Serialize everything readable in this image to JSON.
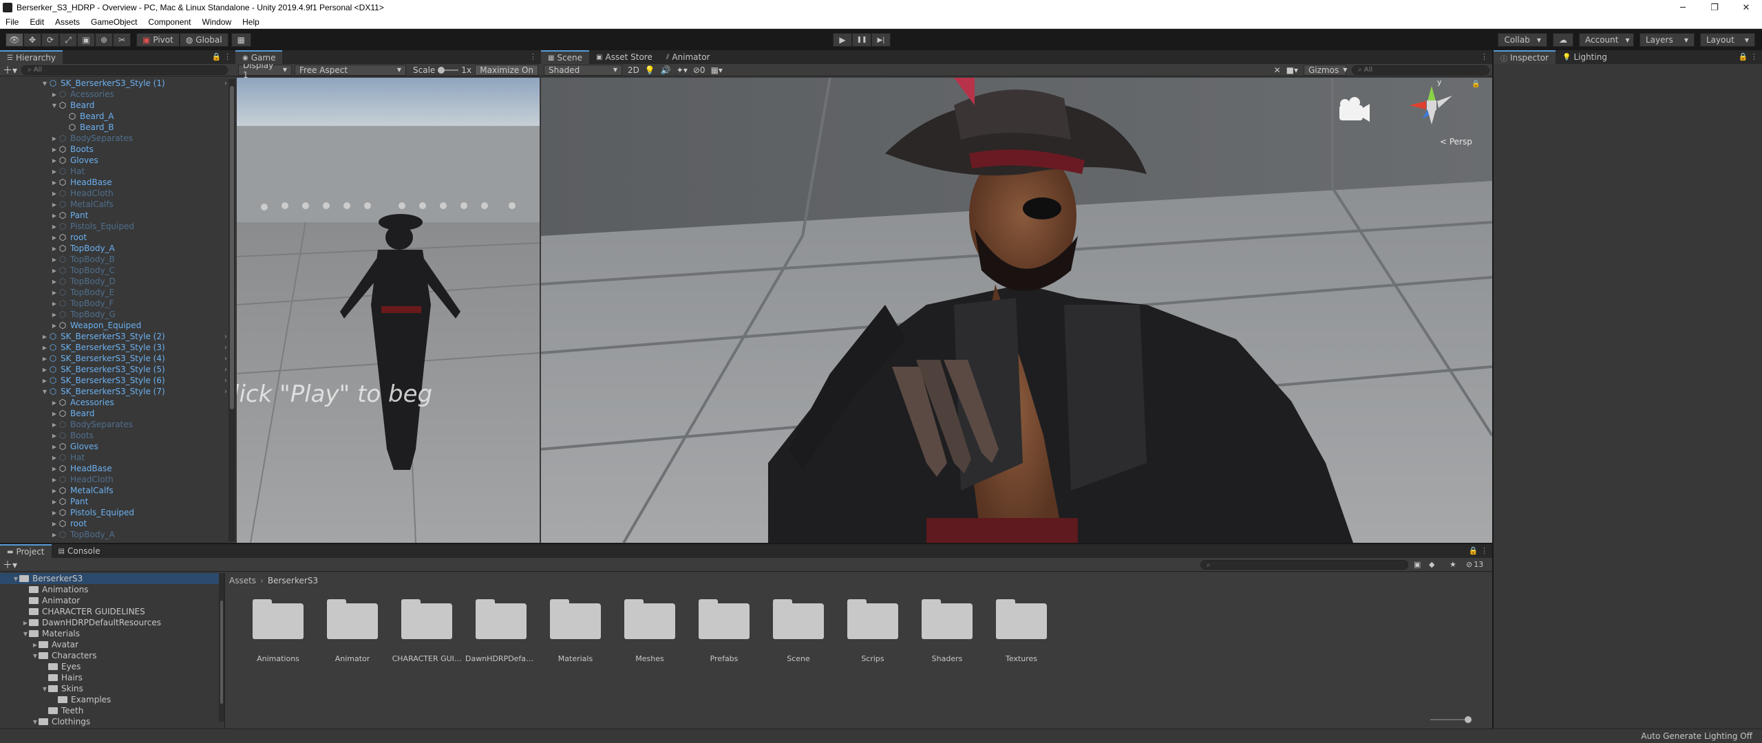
{
  "titlebar": {
    "title": "Berserker_S3_HDRP - Overview - PC, Mac & Linux Standalone - Unity 2019.4.9f1 Personal <DX11>",
    "minimize": "─",
    "restore": "❐",
    "close": "✕"
  },
  "menu": [
    "File",
    "Edit",
    "Assets",
    "GameObject",
    "Component",
    "Window",
    "Help"
  ],
  "toolbar": {
    "pivot": "Pivot",
    "global": "Global",
    "collab": "Collab",
    "account": "Account",
    "layers": "Layers",
    "layout": "Layout",
    "play": "▶",
    "pause": "❚❚",
    "step": "▶|"
  },
  "hierarchy": {
    "tab": "Hierarchy",
    "search": "All",
    "rows": [
      {
        "label": "SK_BerserkerS3_Style (1)",
        "indent": 0,
        "expanded": true,
        "style": "blue",
        "prefab": true,
        "chev": true
      },
      {
        "label": "Acessories",
        "indent": 1,
        "style": "dim"
      },
      {
        "label": "Beard",
        "indent": 1,
        "expanded": true,
        "style": "blue"
      },
      {
        "label": "Beard_A",
        "indent": 2,
        "style": "blue",
        "leaf": true
      },
      {
        "label": "Beard_B",
        "indent": 2,
        "style": "blue",
        "leaf": true
      },
      {
        "label": "BodySeparates",
        "indent": 1,
        "style": "dim"
      },
      {
        "label": "Boots",
        "indent": 1,
        "style": "blue"
      },
      {
        "label": "Gloves",
        "indent": 1,
        "style": "blue"
      },
      {
        "label": "Hat",
        "indent": 1,
        "style": "dim"
      },
      {
        "label": "HeadBase",
        "indent": 1,
        "style": "blue"
      },
      {
        "label": "HeadCloth",
        "indent": 1,
        "style": "dim"
      },
      {
        "label": "MetalCalfs",
        "indent": 1,
        "style": "dim"
      },
      {
        "label": "Pant",
        "indent": 1,
        "style": "blue"
      },
      {
        "label": "Pistols_Equiped",
        "indent": 1,
        "style": "dim"
      },
      {
        "label": "root",
        "indent": 1,
        "style": "blue"
      },
      {
        "label": "TopBody_A",
        "indent": 1,
        "style": "blue"
      },
      {
        "label": "TopBody_B",
        "indent": 1,
        "style": "dim"
      },
      {
        "label": "TopBody_C",
        "indent": 1,
        "style": "dim"
      },
      {
        "label": "TopBody_D",
        "indent": 1,
        "style": "dim"
      },
      {
        "label": "TopBody_E",
        "indent": 1,
        "style": "dim"
      },
      {
        "label": "TopBody_F",
        "indent": 1,
        "style": "dim"
      },
      {
        "label": "TopBody_G",
        "indent": 1,
        "style": "dim"
      },
      {
        "label": "Weapon_Equiped",
        "indent": 1,
        "style": "blue"
      },
      {
        "label": "SK_BerserkerS3_Style (2)",
        "indent": 0,
        "style": "blue",
        "prefab": true,
        "chev": true
      },
      {
        "label": "SK_BerserkerS3_Style (3)",
        "indent": 0,
        "style": "blue",
        "prefab": true,
        "chev": true
      },
      {
        "label": "SK_BerserkerS3_Style (4)",
        "indent": 0,
        "style": "blue",
        "prefab": true,
        "chev": true
      },
      {
        "label": "SK_BerserkerS3_Style (5)",
        "indent": 0,
        "style": "blue",
        "prefab": true,
        "chev": true
      },
      {
        "label": "SK_BerserkerS3_Style (6)",
        "indent": 0,
        "style": "blue",
        "prefab": true,
        "chev": true
      },
      {
        "label": "SK_BerserkerS3_Style (7)",
        "indent": 0,
        "expanded": true,
        "style": "blue",
        "prefab": true,
        "chev": true
      },
      {
        "label": "Acessories",
        "indent": 1,
        "style": "blue"
      },
      {
        "label": "Beard",
        "indent": 1,
        "style": "blue"
      },
      {
        "label": "BodySeparates",
        "indent": 1,
        "style": "dim"
      },
      {
        "label": "Boots",
        "indent": 1,
        "style": "dim"
      },
      {
        "label": "Gloves",
        "indent": 1,
        "style": "blue"
      },
      {
        "label": "Hat",
        "indent": 1,
        "style": "dim"
      },
      {
        "label": "HeadBase",
        "indent": 1,
        "style": "blue"
      },
      {
        "label": "HeadCloth",
        "indent": 1,
        "style": "dim"
      },
      {
        "label": "MetalCalfs",
        "indent": 1,
        "style": "blue"
      },
      {
        "label": "Pant",
        "indent": 1,
        "style": "blue"
      },
      {
        "label": "Pistols_Equiped",
        "indent": 1,
        "style": "blue"
      },
      {
        "label": "root",
        "indent": 1,
        "style": "blue"
      },
      {
        "label": "TopBody_A",
        "indent": 1,
        "style": "dim"
      }
    ]
  },
  "game": {
    "tab": "Game",
    "display": "Display 1",
    "aspect": "Free Aspect",
    "scale_label": "Scale",
    "scale_value": "1x",
    "maximize": "Maximize On",
    "overlay_text": "lick \"Play\" to beg"
  },
  "scene": {
    "tabs": [
      "Scene",
      "Asset Store",
      "Animator"
    ],
    "shading": "Shaded",
    "mode2d": "2D",
    "gizmos": "Gizmos",
    "search": "All",
    "persp": "< Persp",
    "axis_y": "y",
    "hidden_count": "0"
  },
  "inspector": {
    "tabs": [
      "Inspector",
      "Lighting"
    ]
  },
  "project": {
    "tabs": [
      "Project",
      "Console"
    ],
    "breadcrumb": [
      "Assets",
      "BerserkerS3"
    ],
    "count": "13",
    "tree": [
      {
        "label": "BerserkerS3",
        "indent": 0,
        "expanded": true,
        "open": true
      },
      {
        "label": "Animations",
        "indent": 1
      },
      {
        "label": "Animator",
        "indent": 1
      },
      {
        "label": "CHARACTER GUIDELINES",
        "indent": 1
      },
      {
        "label": "DawnHDRPDefaultResources",
        "indent": 1,
        "arrow": true
      },
      {
        "label": "Materials",
        "indent": 1,
        "expanded": true,
        "open": true
      },
      {
        "label": "Avatar",
        "indent": 2,
        "arrow": true
      },
      {
        "label": "Characters",
        "indent": 2,
        "expanded": true,
        "open": true
      },
      {
        "label": "Eyes",
        "indent": 3
      },
      {
        "label": "Hairs",
        "indent": 3
      },
      {
        "label": "Skins",
        "indent": 3,
        "expanded": true,
        "open": true
      },
      {
        "label": "Examples",
        "indent": 4
      },
      {
        "label": "Teeth",
        "indent": 3
      },
      {
        "label": "Clothings",
        "indent": 2,
        "expanded": true,
        "open": true
      }
    ],
    "folders": [
      "Animations",
      "Animator",
      "CHARACTER GUI...",
      "DawnHDRPDefaul...",
      "Materials",
      "Meshes",
      "Prefabs",
      "Scene",
      "Scrips",
      "Shaders",
      "Textures"
    ]
  },
  "status": {
    "text": "Auto Generate Lighting Off"
  },
  "colors": {
    "accent": "#5a9bd8",
    "panel": "#383838",
    "blue_text": "#6bb0f0",
    "dim_text": "#4f6f8e"
  }
}
